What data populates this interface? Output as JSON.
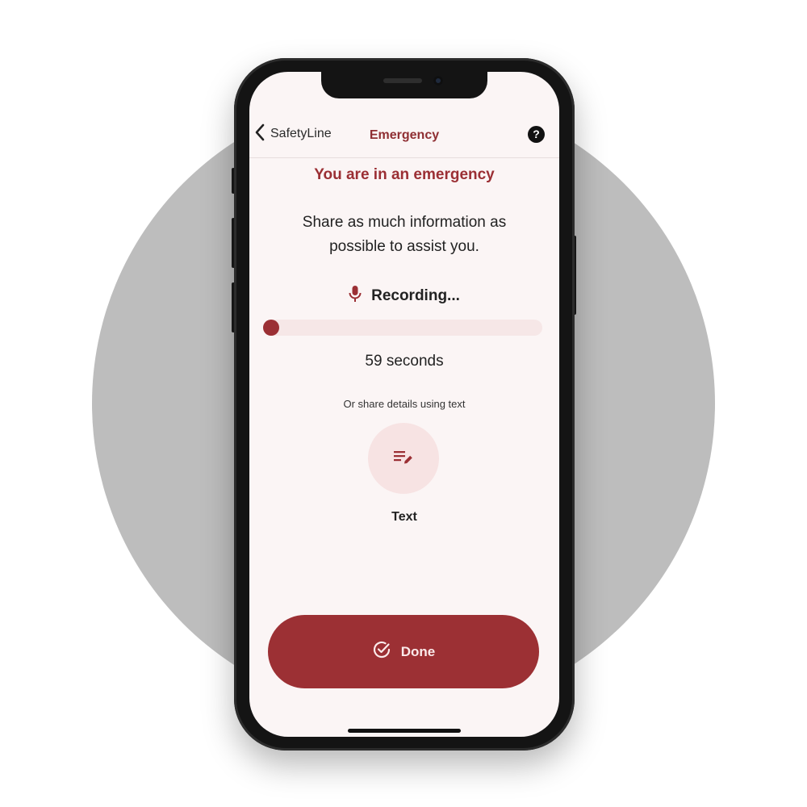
{
  "nav": {
    "back_label": "SafetyLine",
    "title": "Emergency",
    "help_symbol": "?"
  },
  "main": {
    "heading": "You are in an emergency",
    "subtext": "Share as much information as possible to assist you.",
    "recording_label": "Recording...",
    "recording_progress": 0.0,
    "seconds_label": "59 seconds",
    "alt_prompt": "Or share details using text",
    "text_option_label": "Text"
  },
  "actions": {
    "done_label": "Done"
  },
  "icons": {
    "back": "chevron-left-icon",
    "help": "help-icon",
    "recording": "microphone-icon",
    "text": "edit-notes-icon",
    "done": "check-circle-icon"
  },
  "colors": {
    "accent": "#9b2f34",
    "screen_background": "#fbf5f5",
    "track": "#f6e7e7",
    "text_option_background": "#f7e3e3",
    "backdrop_circle": "#bdbdbd"
  }
}
